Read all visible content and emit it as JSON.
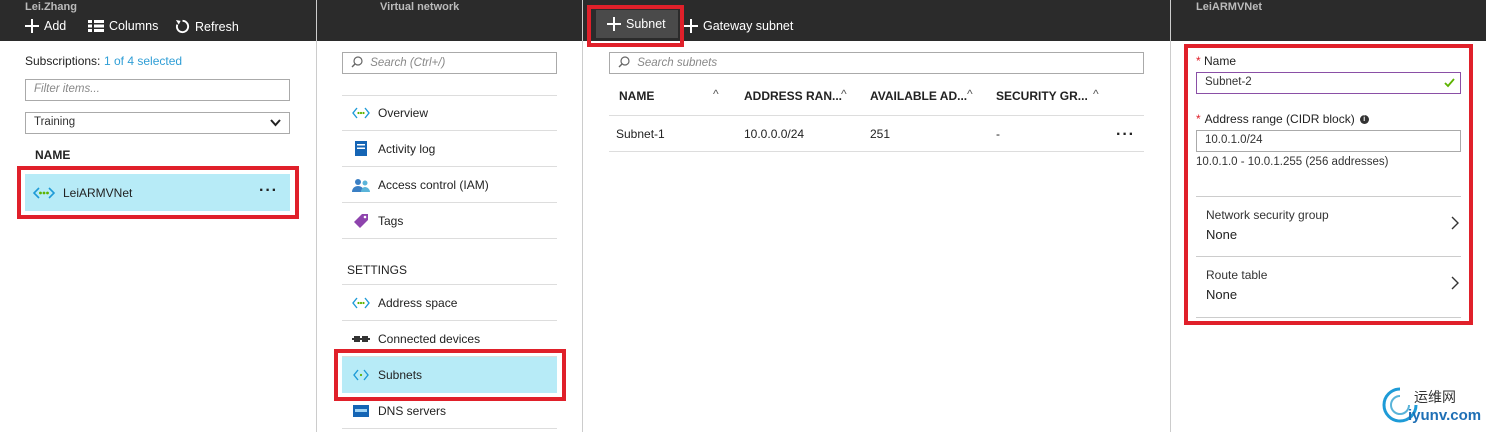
{
  "blade1": {
    "title": "Lei.Zhang",
    "add_label": "Add",
    "columns_label": "Columns",
    "refresh_label": "Refresh",
    "subscriptions_label": "Subscriptions:",
    "subscriptions_value": "1 of 4 selected",
    "filter_placeholder": "Filter items...",
    "resource_group": "Training",
    "column_header": "NAME",
    "item_name": "LeiARMVNet"
  },
  "blade2": {
    "title": "Virtual network",
    "search_placeholder": "Search (Ctrl+/)",
    "menu": [
      "Overview",
      "Activity log",
      "Access control (IAM)",
      "Tags"
    ],
    "settings_label": "SETTINGS",
    "settings_menu": [
      "Address space",
      "Connected devices",
      "Subnets",
      "DNS servers"
    ]
  },
  "blade3": {
    "subnet_button": "Subnet",
    "gateway_button": "Gateway subnet",
    "search_placeholder": "Search subnets",
    "columns": [
      "NAME",
      "ADDRESS RAN...",
      "AVAILABLE AD...",
      "SECURITY GR..."
    ],
    "rows": [
      {
        "name": "Subnet-1",
        "range": "10.0.0.0/24",
        "available": "251",
        "security": "-"
      }
    ]
  },
  "blade4": {
    "title": "LeiARMVNet",
    "name_label": "Name",
    "name_value": "Subnet-2",
    "range_label": "Address range (CIDR block)",
    "range_value": "10.0.1.0/24",
    "range_hint": "10.0.1.0 - 10.0.1.255 (256 addresses)",
    "nsg_label": "Network security group",
    "nsg_value": "None",
    "route_label": "Route table",
    "route_value": "None"
  },
  "watermark": {
    "cn": "运维网",
    "en": "iyunv.com"
  },
  "colors": {
    "accent": "#2f9ed6",
    "selected": "#b7ebf7",
    "highlight": "#e0202a",
    "topbar": "#2b2b2b",
    "valid": "#5db300"
  }
}
